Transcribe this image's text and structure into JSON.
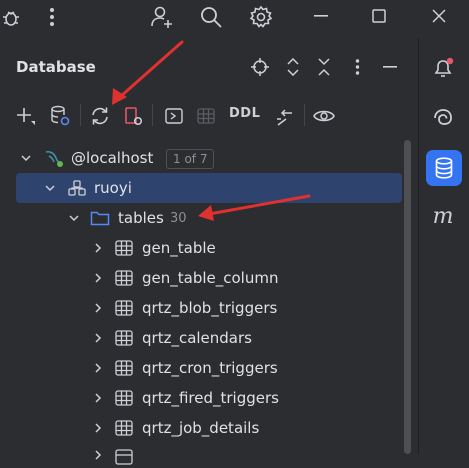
{
  "window": {
    "tool_window_title": "Database"
  },
  "toolbar": {
    "ddl_label": "DDL"
  },
  "tree": {
    "connection": {
      "name": "@localhost",
      "badge": "1 of 7"
    },
    "schema": {
      "name": "ruoyi"
    },
    "folder": {
      "name": "tables",
      "count": "30"
    },
    "tables": [
      "gen_table",
      "gen_table_column",
      "qrtz_blob_triggers",
      "qrtz_calendars",
      "qrtz_cron_triggers",
      "qrtz_fired_triggers",
      "qrtz_job_details"
    ]
  },
  "side": {
    "m_label": "m"
  },
  "colors": {
    "accent": "#3574f0",
    "selection": "#2e436e",
    "annotation_arrow": "#e03131",
    "folder": "#548af7",
    "notification_dot": "#e55765"
  }
}
